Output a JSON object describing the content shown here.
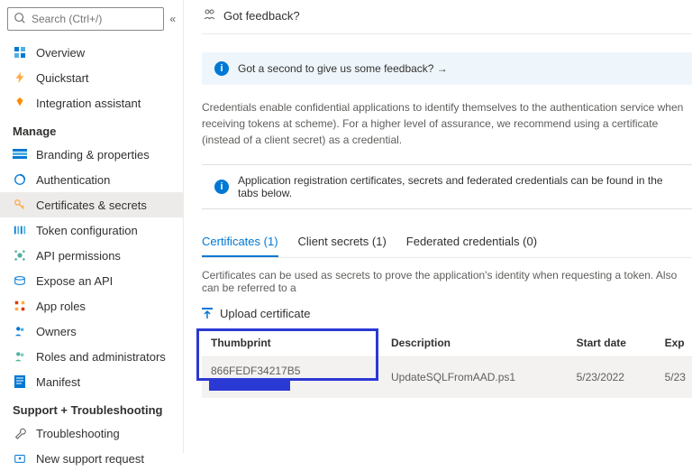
{
  "search": {
    "placeholder": "Search (Ctrl+/)"
  },
  "nav": {
    "top": [
      {
        "label": "Overview",
        "color": "#0078d4"
      },
      {
        "label": "Quickstart",
        "color": "#ffaa44"
      },
      {
        "label": "Integration assistant",
        "color": "#ff8c00"
      }
    ],
    "manage_header": "Manage",
    "manage": [
      {
        "label": "Branding & properties",
        "color": "#0078d4"
      },
      {
        "label": "Authentication",
        "color": "#0078d4"
      },
      {
        "label": "Certificates & secrets",
        "color": "#ffaa44",
        "active": true
      },
      {
        "label": "Token configuration",
        "color": "#0078d4"
      },
      {
        "label": "API permissions",
        "color": "#50b0a0"
      },
      {
        "label": "Expose an API",
        "color": "#0078d4"
      },
      {
        "label": "App roles",
        "color": "#d83b01"
      },
      {
        "label": "Owners",
        "color": "#0078d4"
      },
      {
        "label": "Roles and administrators",
        "color": "#50b0a0"
      },
      {
        "label": "Manifest",
        "color": "#0078d4"
      }
    ],
    "support_header": "Support + Troubleshooting",
    "support": [
      {
        "label": "Troubleshooting",
        "color": "#605e5c"
      },
      {
        "label": "New support request",
        "color": "#0078d4"
      }
    ]
  },
  "header": {
    "feedback": "Got feedback?"
  },
  "feedback_box": "Got a second to give us some feedback? →",
  "description": "Credentials enable confidential applications to identify themselves to the authentication service when receiving tokens at scheme). For a higher level of assurance, we recommend using a certificate (instead of a client secret) as a credential.",
  "note": "Application registration certificates, secrets and federated credentials can be found in the tabs below.",
  "tabs": {
    "items": [
      {
        "label": "Certificates (1)",
        "active": true
      },
      {
        "label": "Client secrets (1)",
        "active": false
      },
      {
        "label": "Federated credentials (0)",
        "active": false
      }
    ]
  },
  "tab_description": "Certificates can be used as secrets to prove the application's identity when requesting a token. Also can be referred to a",
  "upload_label": "Upload certificate",
  "table": {
    "headers": {
      "thumbprint": "Thumbprint",
      "description": "Description",
      "start_date": "Start date",
      "expires": "Exp"
    },
    "row": {
      "thumbprint": "866FEDF34217B5",
      "description": "UpdateSQLFromAAD.ps1",
      "start_date": "5/23/2022",
      "expires": "5/23"
    }
  }
}
